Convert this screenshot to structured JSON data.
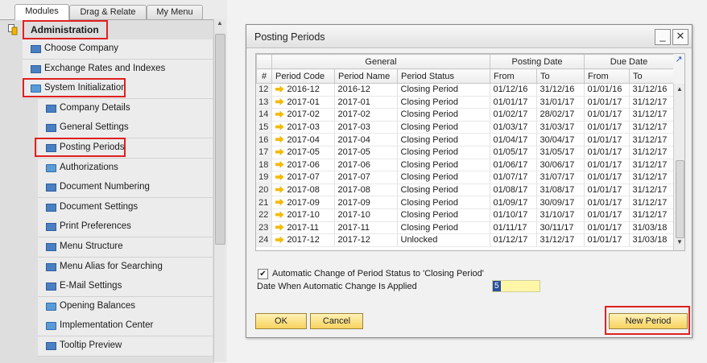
{
  "tabs": {
    "modules": "Modules",
    "drag": "Drag & Relate",
    "menu": "My Menu"
  },
  "tree": {
    "admin": "Administration",
    "nodes": [
      {
        "label": "Choose Company",
        "level": 0,
        "icon": "doc-icon"
      },
      {
        "label": "Exchange Rates and Indexes",
        "level": 0,
        "icon": "doc-icon"
      },
      {
        "label": "System Initialization",
        "level": 0,
        "icon": "folder-open-icon"
      },
      {
        "label": "Company Details",
        "level": 1,
        "icon": "doc-icon"
      },
      {
        "label": "General Settings",
        "level": 1,
        "icon": "doc-icon"
      },
      {
        "label": "Posting Periods",
        "level": 1,
        "icon": "doc-icon"
      },
      {
        "label": "Authorizations",
        "level": 1,
        "icon": "folder-icon"
      },
      {
        "label": "Document Numbering",
        "level": 1,
        "icon": "doc-icon"
      },
      {
        "label": "Document Settings",
        "level": 1,
        "icon": "doc-icon"
      },
      {
        "label": "Print Preferences",
        "level": 1,
        "icon": "doc-icon"
      },
      {
        "label": "Menu Structure",
        "level": 1,
        "icon": "doc-icon"
      },
      {
        "label": "Menu Alias for Searching",
        "level": 1,
        "icon": "doc-icon"
      },
      {
        "label": "E-Mail Settings",
        "level": 1,
        "icon": "doc-icon"
      },
      {
        "label": "Opening Balances",
        "level": 1,
        "icon": "folder-icon"
      },
      {
        "label": "Implementation Center",
        "level": 1,
        "icon": "folder-icon"
      },
      {
        "label": "Tooltip Preview",
        "level": 1,
        "icon": "doc-icon"
      }
    ]
  },
  "window": {
    "title": "Posting Periods",
    "group_headers": {
      "general": "General",
      "posting": "Posting Date",
      "due": "Due Date"
    },
    "columns": {
      "idx": "#",
      "code": "Period Code",
      "name": "Period Name",
      "status": "Period Status",
      "pfrom": "From",
      "pto": "To",
      "dfrom": "From",
      "dto": "To"
    },
    "rows": [
      [
        "12",
        "2016-12",
        "2016-12",
        "Closing Period",
        "01/12/16",
        "31/12/16",
        "01/01/16",
        "31/12/16"
      ],
      [
        "13",
        "2017-01",
        "2017-01",
        "Closing Period",
        "01/01/17",
        "31/01/17",
        "01/01/17",
        "31/12/17"
      ],
      [
        "14",
        "2017-02",
        "2017-02",
        "Closing Period",
        "01/02/17",
        "28/02/17",
        "01/01/17",
        "31/12/17"
      ],
      [
        "15",
        "2017-03",
        "2017-03",
        "Closing Period",
        "01/03/17",
        "31/03/17",
        "01/01/17",
        "31/12/17"
      ],
      [
        "16",
        "2017-04",
        "2017-04",
        "Closing Period",
        "01/04/17",
        "30/04/17",
        "01/01/17",
        "31/12/17"
      ],
      [
        "17",
        "2017-05",
        "2017-05",
        "Closing Period",
        "01/05/17",
        "31/05/17",
        "01/01/17",
        "31/12/17"
      ],
      [
        "18",
        "2017-06",
        "2017-06",
        "Closing Period",
        "01/06/17",
        "30/06/17",
        "01/01/17",
        "31/12/17"
      ],
      [
        "19",
        "2017-07",
        "2017-07",
        "Closing Period",
        "01/07/17",
        "31/07/17",
        "01/01/17",
        "31/12/17"
      ],
      [
        "20",
        "2017-08",
        "2017-08",
        "Closing Period",
        "01/08/17",
        "31/08/17",
        "01/01/17",
        "31/12/17"
      ],
      [
        "21",
        "2017-09",
        "2017-09",
        "Closing Period",
        "01/09/17",
        "30/09/17",
        "01/01/17",
        "31/12/17"
      ],
      [
        "22",
        "2017-10",
        "2017-10",
        "Closing Period",
        "01/10/17",
        "31/10/17",
        "01/01/17",
        "31/12/17"
      ],
      [
        "23",
        "2017-11",
        "2017-11",
        "Closing Period",
        "01/11/17",
        "30/11/17",
        "01/01/17",
        "31/03/18"
      ],
      [
        "24",
        "2017-12",
        "2017-12",
        "Unlocked",
        "01/12/17",
        "31/12/17",
        "01/01/17",
        "31/03/18"
      ]
    ],
    "auto_change_label": "Automatic Change of Period Status to 'Closing Period'",
    "auto_change_checked": true,
    "date_label": "Date When Automatic Change Is Applied",
    "date_value": "5",
    "ok_label": "OK",
    "cancel_label": "Cancel",
    "new_period_label": "New Period"
  },
  "colors": {
    "highlight": "#e02020",
    "button": "#f7d25e",
    "input": "#fff6a8"
  }
}
